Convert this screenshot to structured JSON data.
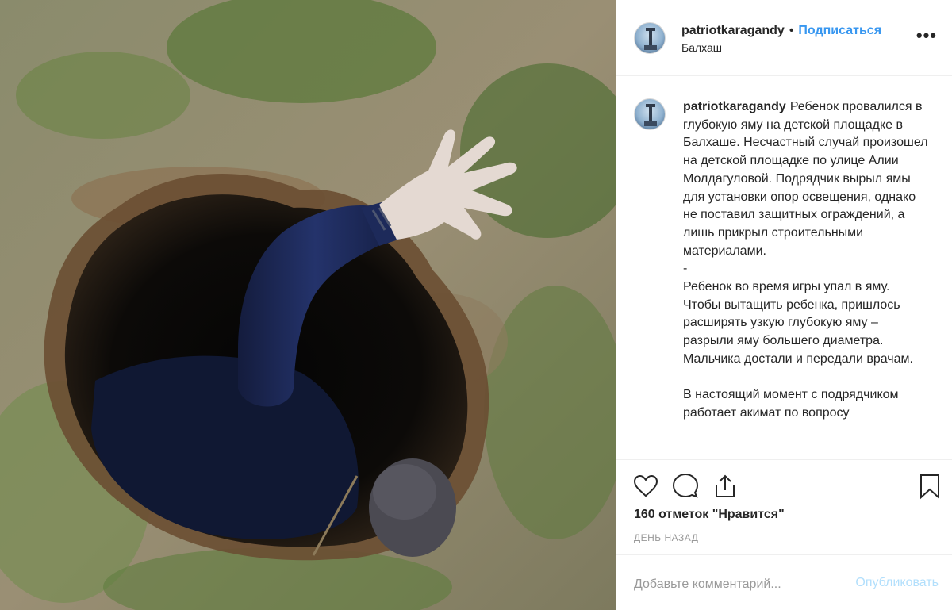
{
  "post": {
    "username": "patriotkaragandy",
    "separator": "•",
    "follow_label": "Подписаться",
    "location": "Балхаш",
    "more_label": "•••",
    "caption_text": "Ребенок провалился в глубокую яму на детской площадке в Балхаше. Несчастный случай произошел на детской площадке по улице Алии Молдагуловой. Подрядчик вырыл ямы для установки опор освещения, однако не поставил защитных ограждений, а лишь прикрыл строительными материалами.\n-\nРебенок во время игры упал в яму. Чтобы вытащить ребенка, пришлось расширять узкую глубокую яму – разрыли яму большего диаметра. Мальчика достали и передали врачам.\n\nВ настоящий момент с подрядчиком работает акимат по вопросу",
    "likes_text": "160 отметок \"Нравится\"",
    "time_text": "ДЕНЬ НАЗАД"
  },
  "actions": {
    "like_icon": "heart-icon",
    "comment_icon": "comment-icon",
    "share_icon": "share-icon",
    "save_icon": "bookmark-icon"
  },
  "comment": {
    "placeholder": "Добавьте комментарий...",
    "publish_label": "Опубликовать"
  },
  "colors": {
    "link": "#3897f0",
    "publish_disabled": "#b2dffc",
    "muted": "#999999"
  }
}
